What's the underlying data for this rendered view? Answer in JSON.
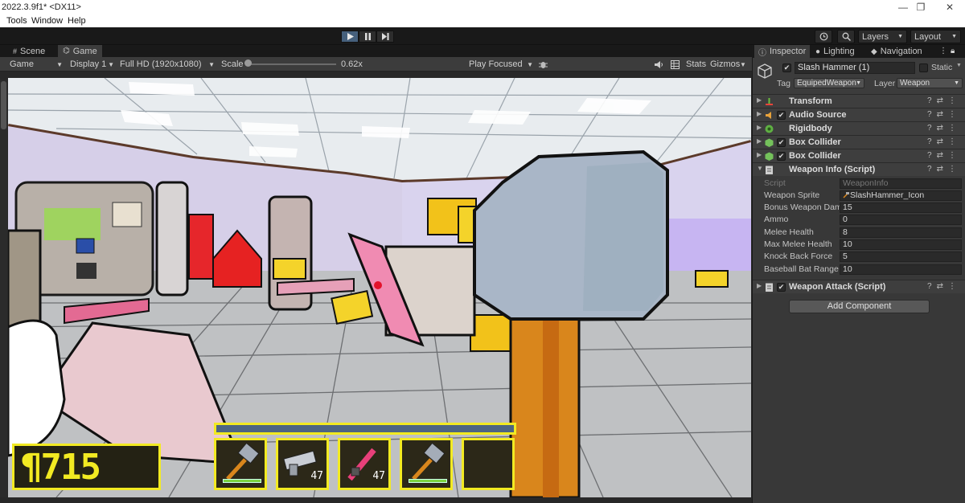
{
  "window": {
    "title": "2022.3.9f1* <DX11>",
    "minimize": "—",
    "maximize": "❐",
    "close": "✕"
  },
  "menu": [
    "Tools",
    "Window",
    "Help"
  ],
  "toolbar": {
    "history_icon": "history-icon",
    "search_icon": "search-icon",
    "layers_label": "Layers",
    "layout_label": "Layout"
  },
  "game_panel": {
    "tabs": [
      {
        "label": "Scene",
        "icon": "grid-icon"
      },
      {
        "label": "Game",
        "icon": "gamepad-icon"
      }
    ],
    "controls": {
      "mode": "Game",
      "display": "Display 1",
      "resolution": "Full HD (1920x1080)",
      "scale_label": "Scale",
      "scale_value": "0.62x",
      "scale_fraction": 0.02,
      "play_mode": "Play Focused",
      "stats": "Stats",
      "gizmos": "Gizmos"
    },
    "hud": {
      "score": "¶715",
      "slots": [
        {
          "item": "hammer",
          "count": "",
          "health_bar": true
        },
        {
          "item": "wrench-gun",
          "count": "47",
          "health_bar": false
        },
        {
          "item": "red-blaster",
          "count": "47",
          "health_bar": false
        },
        {
          "item": "hammer",
          "count": "",
          "health_bar": true
        },
        {
          "item": "empty",
          "count": "",
          "health_bar": false
        }
      ]
    },
    "colors": {
      "hud_yellow": "#f2ea22",
      "hud_bar_blue": "#4d6582",
      "health_green": "#7bd341"
    }
  },
  "inspector": {
    "tabs": [
      {
        "label": "Inspector",
        "icon": "info-icon"
      },
      {
        "label": "Lighting",
        "icon": "bulb-icon"
      },
      {
        "label": "Navigation",
        "icon": "navigation-icon"
      }
    ],
    "object": {
      "name": "Slash Hammer (1)",
      "static_label": "Static",
      "tag_label": "Tag",
      "tag_value": "EquipedWeapon",
      "layer_label": "Layer",
      "layer_value": "Weapon"
    },
    "components": [
      {
        "name": "Transform",
        "checkbox": false,
        "expanded": false,
        "icon_color": "#6bbf3d"
      },
      {
        "name": "Audio Source",
        "checkbox": true,
        "expanded": false,
        "icon_color": "#e8a23b"
      },
      {
        "name": "Rigidbody",
        "checkbox": false,
        "expanded": false,
        "icon_color": "#5fb043"
      },
      {
        "name": "Box Collider",
        "checkbox": true,
        "expanded": false,
        "icon_color": "#74c15b"
      },
      {
        "name": "Box Collider",
        "checkbox": true,
        "expanded": false,
        "icon_color": "#74c15b"
      },
      {
        "name": "Weapon Info (Script)",
        "checkbox": false,
        "expanded": true,
        "icon_color": "#cfcfcf"
      }
    ],
    "weapon_info": [
      {
        "label": "Script",
        "value": "WeaponInfo",
        "dim": true
      },
      {
        "label": "Weapon Sprite",
        "value": "SlashHammer_Icon",
        "dim": false
      },
      {
        "label": "Bonus Weapon Dama",
        "value": "15",
        "dim": false
      },
      {
        "label": "Ammo",
        "value": "0",
        "dim": false
      },
      {
        "label": "Melee Health",
        "value": "8",
        "dim": false
      },
      {
        "label": "Max Melee Health",
        "value": "10",
        "dim": false
      },
      {
        "label": "Knock Back Force",
        "value": "5",
        "dim": false
      },
      {
        "label": "Baseball Bat Range",
        "value": "10",
        "dim": false
      }
    ],
    "weapon_attack": {
      "name": "Weapon Attack (Script)"
    },
    "add_component": "Add Component"
  }
}
